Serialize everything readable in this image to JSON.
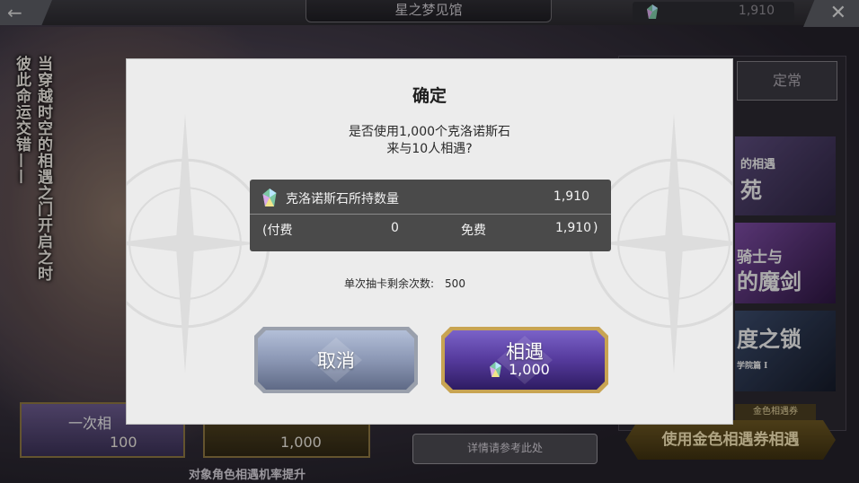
{
  "header": {
    "back_icon": "arrow-left-icon",
    "title": "星之梦见馆",
    "currency_value": "1,910",
    "close_icon": "close-icon"
  },
  "background": {
    "side_text_1": "当穿越时空的相遇之门开启之时",
    "side_text_2": "彼此命运交错——",
    "tab_label": "定常",
    "banner1_line1": "的相遇",
    "banner1_line2": "苑",
    "banner2_line1": "骑士与",
    "banner2_line2": "的魔剑",
    "banner3_line1": "度之锁",
    "banner3_line2": "学院篇 I",
    "single_pull_label": "一次相",
    "single_pull_cost": "100",
    "ten_pull_cost": "1,000",
    "detail_button": "详情请参考此处",
    "ticket_badge": "金色相遇券",
    "ticket_button": "使用金色相遇券相遇",
    "bottom_caption": "对象角色相遇机率提升"
  },
  "dialog": {
    "title": "确定",
    "message_line1": "是否使用1,000个克洛诺斯石",
    "message_line2": "来与10人相遇?",
    "stone_label": "克洛诺斯石所持数量",
    "stone_total": "1,910",
    "paid_label": "(付费",
    "paid_value": "0",
    "free_label": "免费",
    "free_value": "1,910",
    "close_paren": ")",
    "remaining_label": "单次抽卡剩余次数:",
    "remaining_value": "500",
    "cancel_button": "取消",
    "confirm_button": "相遇",
    "confirm_cost": "1,000"
  },
  "colors": {
    "modal_bg": "#ececec",
    "stone_box_bg": "#4a4a4a",
    "cancel_button": "#8f9bb8",
    "confirm_button": "#5a3fa0",
    "gold_border": "#c8a452"
  }
}
